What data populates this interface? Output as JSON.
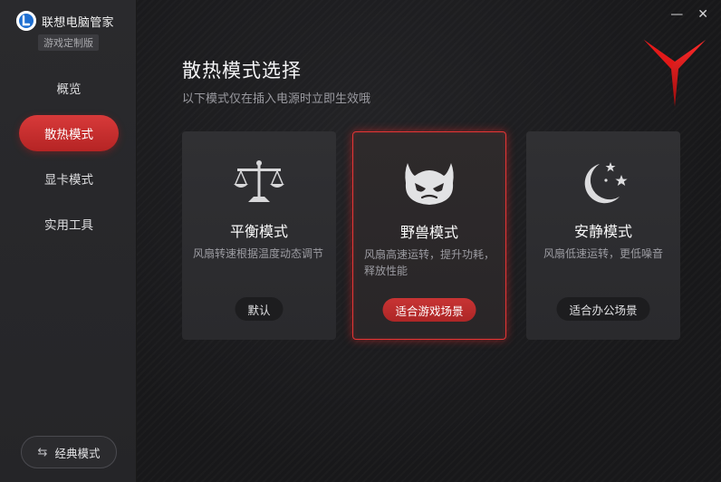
{
  "app": {
    "title": "联想电脑管家",
    "edition": "游戏定制版"
  },
  "sidebar": {
    "items": [
      {
        "label": "概览",
        "active": false
      },
      {
        "label": "散热模式",
        "active": true
      },
      {
        "label": "显卡模式",
        "active": false
      },
      {
        "label": "实用工具",
        "active": false
      }
    ],
    "classic_label": "经典模式",
    "classic_icon": "swap-icon"
  },
  "window_controls": {
    "minimize": "—",
    "close": "✕"
  },
  "page": {
    "title": "散热模式选择",
    "subtitle": "以下模式仅在插入电源时立即生效哦"
  },
  "modes": [
    {
      "name": "平衡模式",
      "desc": "风扇转速根据温度动态调节",
      "tag": "默认",
      "icon": "balance-scale-icon",
      "selected": false
    },
    {
      "name": "野兽模式",
      "desc": "风扇高速运转，提升功耗，释放性能",
      "tag": "适合游戏场景",
      "icon": "beast-face-icon",
      "selected": true
    },
    {
      "name": "安静模式",
      "desc": "风扇低速运转，更低噪音",
      "tag": "适合办公场景",
      "icon": "moon-stars-icon",
      "selected": false
    }
  ],
  "colors": {
    "accent": "#d32f2f",
    "sidebar_bg": "#2a2a2d",
    "main_bg": "#1b1b1d",
    "card_bg": "#2e2e31"
  }
}
